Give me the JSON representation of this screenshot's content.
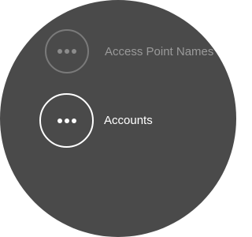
{
  "screen": {
    "background_color": "#4a4a4a",
    "items": [
      {
        "label": "Access Point Names",
        "icon": "more-horizontal-icon",
        "state": "dimmed",
        "label_color": "#9a9a9a"
      },
      {
        "label": "Accounts",
        "icon": "more-horizontal-icon",
        "state": "focused",
        "label_color": "#ffffff"
      }
    ]
  }
}
